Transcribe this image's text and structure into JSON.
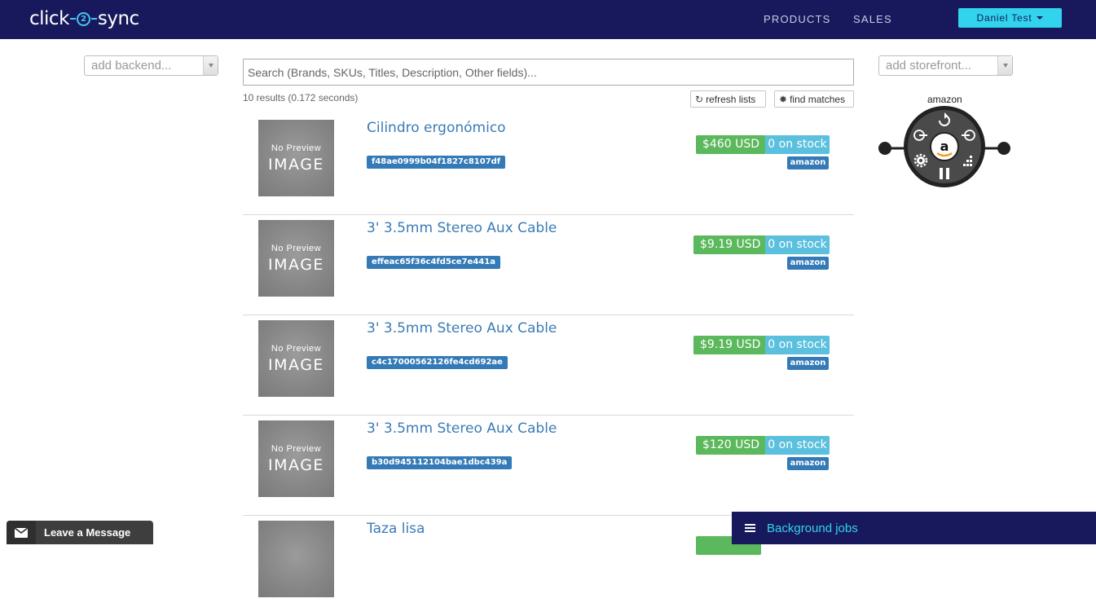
{
  "navbar": {
    "brand_left": "click",
    "brand_mid": "2",
    "brand_right": "sync",
    "links": [
      "PRODUCTS",
      "SALES"
    ],
    "user": "Daniel Test"
  },
  "filters": {
    "backend_placeholder": "add backend...",
    "storefront_placeholder": "add storefront...",
    "search_placeholder": "Search (Brands, SKUs, Titles, Description, Other fields)..."
  },
  "results_info": "10 results (0.172 seconds)",
  "actions": {
    "refresh": "refresh lists",
    "find": "find matches"
  },
  "thumb": {
    "line1": "No Preview",
    "line2": "IMAGE"
  },
  "products": [
    {
      "title": "Cilindro ergonómico",
      "sku": "f48ae0999b04f1827c8107df",
      "price": "$460 USD",
      "stock": "0 on stock",
      "store": "amazon"
    },
    {
      "title": "3' 3.5mm Stereo Aux Cable",
      "sku": "effeac65f36c4fd5ce7e441a",
      "price": "$9.19 USD",
      "stock": "0 on stock",
      "store": "amazon"
    },
    {
      "title": "3' 3.5mm Stereo Aux Cable",
      "sku": "c4c17000562126fe4cd692ae",
      "price": "$9.19 USD",
      "stock": "0 on stock",
      "store": "amazon"
    },
    {
      "title": "3' 3.5mm Stereo Aux Cable",
      "sku": "b30d945112104bae1dbc439a",
      "price": "$120 USD",
      "stock": "0 on stock",
      "store": "amazon"
    },
    {
      "title": "Taza lisa",
      "sku": "",
      "price": "",
      "stock": "",
      "store": ""
    }
  ],
  "storefront": {
    "name": "amazon",
    "logo_letter": "a"
  },
  "footer": {
    "leave_message": "Leave a Message",
    "background_jobs": "Background jobs"
  },
  "colors": {
    "navbar": "#17195c",
    "accent": "#31d4ec",
    "price": "#5cb85c",
    "stock": "#5bc0de",
    "tag": "#337ab7",
    "link": "#3b7bb6"
  }
}
